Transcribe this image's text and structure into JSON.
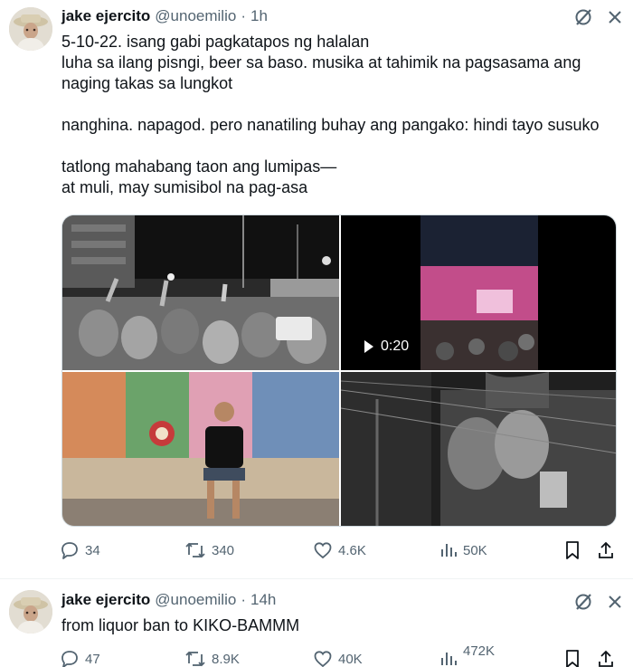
{
  "colors": {
    "text": "#0f1419",
    "muted": "#536471",
    "border": "#cfd9de"
  },
  "icons": [
    "grok-icon",
    "more-icon",
    "reply-icon",
    "retweet-icon",
    "like-icon",
    "views-icon",
    "bookmark-icon",
    "share-icon",
    "play-icon"
  ],
  "tweets": [
    {
      "name": "jake ejercito",
      "handle": "@unoemilio",
      "dot": "·",
      "time": "1h",
      "text_lines": [
        "5-10-22. isang gabi pagkatapos ng halalan",
        "luha sa ilang pisngi, beer sa baso. musika at tahimik na pagsasama ang naging takas sa lungkot",
        "nanghina. napagod. pero nanatiling buhay ang pangako: hindi tayo susuko",
        "tatlong mahabang taon ang lumipas—",
        "at muli, may sumisibol na pag-asa"
      ],
      "video_duration": "0:20",
      "stats": {
        "replies": "34",
        "retweets": "340",
        "likes": "4.6K",
        "views": "50K"
      }
    },
    {
      "name": "jake ejercito",
      "handle": "@unoemilio",
      "dot": "·",
      "time": "14h",
      "text": "from liquor ban to KIKO-BAMMM",
      "stats": {
        "replies": "47",
        "retweets": "8.9K",
        "likes": "40K",
        "views": "472K"
      }
    }
  ]
}
